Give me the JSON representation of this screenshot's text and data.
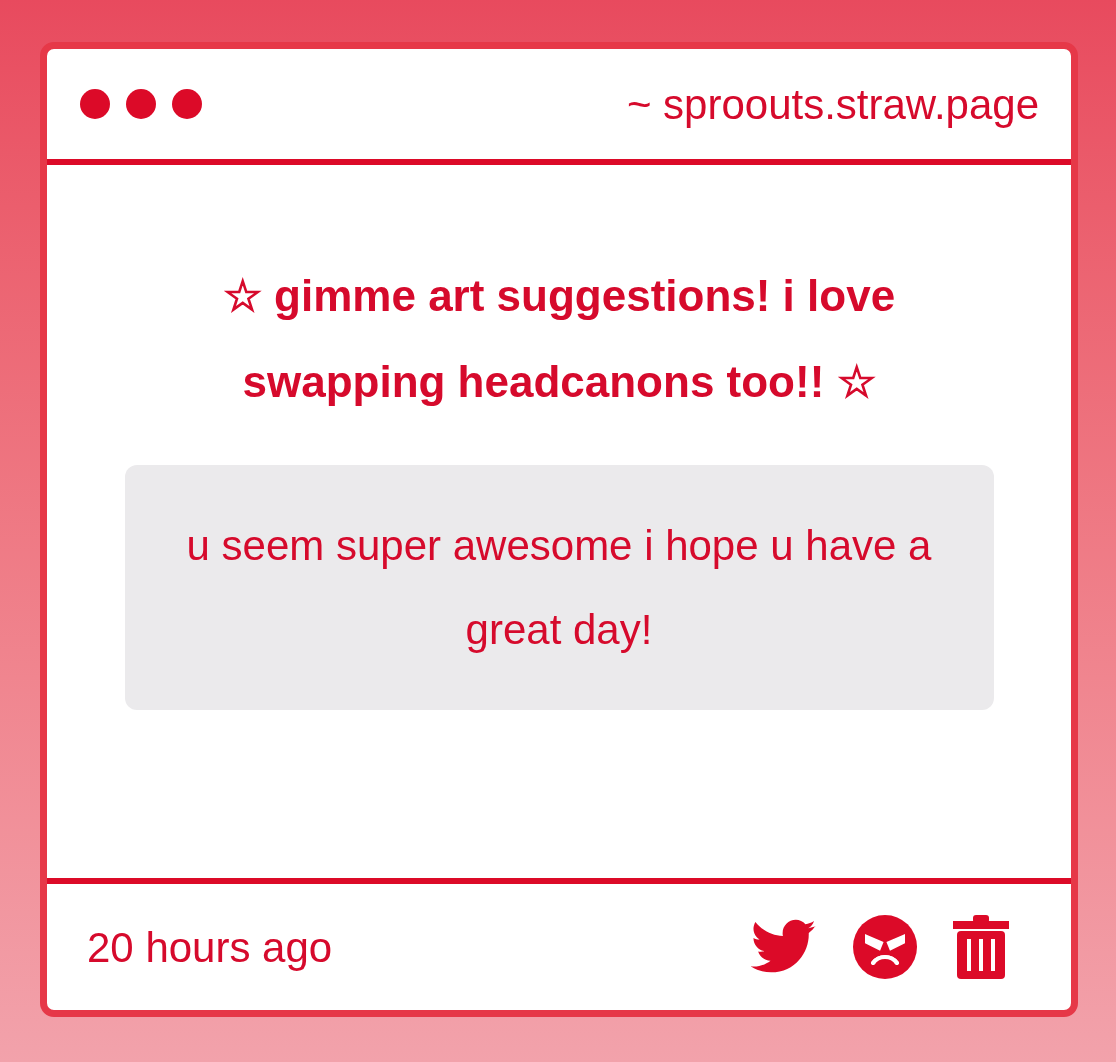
{
  "window": {
    "address": "~ sproouts.straw.page"
  },
  "prompt": "☆ gimme art suggestions! i love swapping headcanons too!! ☆",
  "message": "u seem super awesome i hope u have a great day!",
  "footer": {
    "time": "20 hours ago"
  }
}
